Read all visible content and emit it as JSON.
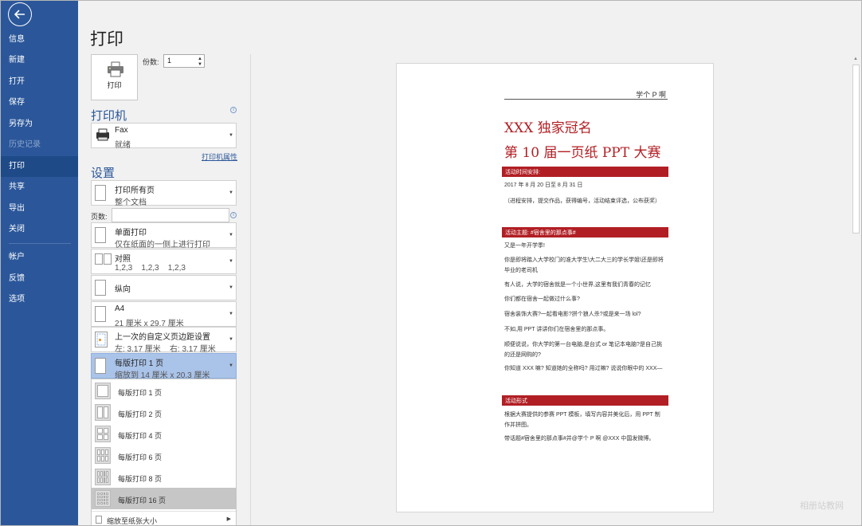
{
  "nav": {
    "items": [
      {
        "label": "信息",
        "state": "normal"
      },
      {
        "label": "新建",
        "state": "normal"
      },
      {
        "label": "打开",
        "state": "normal"
      },
      {
        "label": "保存",
        "state": "normal"
      },
      {
        "label": "另存为",
        "state": "normal"
      },
      {
        "label": "历史记录",
        "state": "disabled"
      },
      {
        "label": "打印",
        "state": "active"
      },
      {
        "label": "共享",
        "state": "normal"
      },
      {
        "label": "导出",
        "state": "normal"
      },
      {
        "label": "关闭",
        "state": "normal"
      },
      {
        "label": "帐户",
        "state": "normal"
      },
      {
        "label": "反馈",
        "state": "normal"
      },
      {
        "label": "选项",
        "state": "normal"
      }
    ]
  },
  "print": {
    "title": "打印",
    "print_button_label": "打印",
    "copies_label": "份数:",
    "copies_value": "1"
  },
  "printer": {
    "heading": "打印机",
    "name": "Fax",
    "status": "就绪",
    "properties_link": "打印机属性"
  },
  "settings": {
    "heading": "设置",
    "scope_main": "打印所有页",
    "scope_sub": "整个文档",
    "pages_label": "页数:",
    "pages_value": "",
    "sides_main": "单面打印",
    "sides_sub": "仅在纸面的一侧上进行打印",
    "collate_main": "对照",
    "collate_sub": "1,2,3    1,2,3    1,2,3",
    "orientation_main": "纵向",
    "paper_main": "A4",
    "paper_sub": "21 厘米 x 29.7 厘米",
    "margins_main": "上一次的自定义页边距设置",
    "margins_sub": "左: 3.17 厘米    右: 3.17 厘米",
    "perpage_main": "每版打印 1 页",
    "perpage_sub": "缩放到 14 厘米 x 20.3 厘米"
  },
  "pages_per_sheet_menu": {
    "options": [
      "每版打印 1 页",
      "每版打印 2 页",
      "每版打印 4 页",
      "每版打印 6 页",
      "每版打印 8 页",
      "每版打印 16 页"
    ],
    "highlighted": "每版打印 16 页",
    "scale_option": "缩放至纸张大小"
  },
  "preview": {
    "header_right": "学个 P 啊",
    "title_line1": "XXX 独家冠名",
    "title_line2": "第 10 届一页纸 PPT 大赛",
    "sec1_bar": "活动时间安排:",
    "sec1_p1": "2017 年 8 月 20 日至 8 月 31 日",
    "sec1_p2": "（进程安排，提交作品，获得编号，活动结束评选，公布获奖）",
    "sec2_bar": "活动主题: #宿舍里的那点事#",
    "sec2_p1": "又是一年开学季!",
    "sec2_p2": "你是即将踏入大学校门的准大学生\\大二大三的学长学姐\\还是即将毕业的老司机",
    "sec2_p3": "有人说，大学的宿舍就是一个小世界,这里有我们青春的记忆",
    "sec2_p4": "你们都在宿舍一起做过什么事?",
    "sec2_p5": "宿舍装饰大赛?一起看电影?拼个狼人杀?或是来一场 lol?",
    "sec2_p6": "不如,用 PPT 讲讲你们在宿舍里的那点事。",
    "sec2_p7": "顺便说说，你大学的第一台电脑,是台式 or 笔记本电脑?是自己挑的还是网购的?",
    "sec2_p8": "你知道 XXX 嘛? 知道她的全称吗? 用过嘛? 说说你眼中的 XXX—",
    "sec3_bar": "活动形式",
    "sec3_p1": "根据大赛提供的参赛 PPT 模板，填写内容并美化后，用 PPT 制作并拼图。",
    "sec3_p2": "带话题#宿舍里的那点事#并@学个 P 啊 @XXX 中国发微博。"
  },
  "watermark": "相册站教网",
  "colors": {
    "nav_bg": "#2b579a",
    "accent_red": "#b11f24",
    "selected_bg": "#aac3e8"
  }
}
